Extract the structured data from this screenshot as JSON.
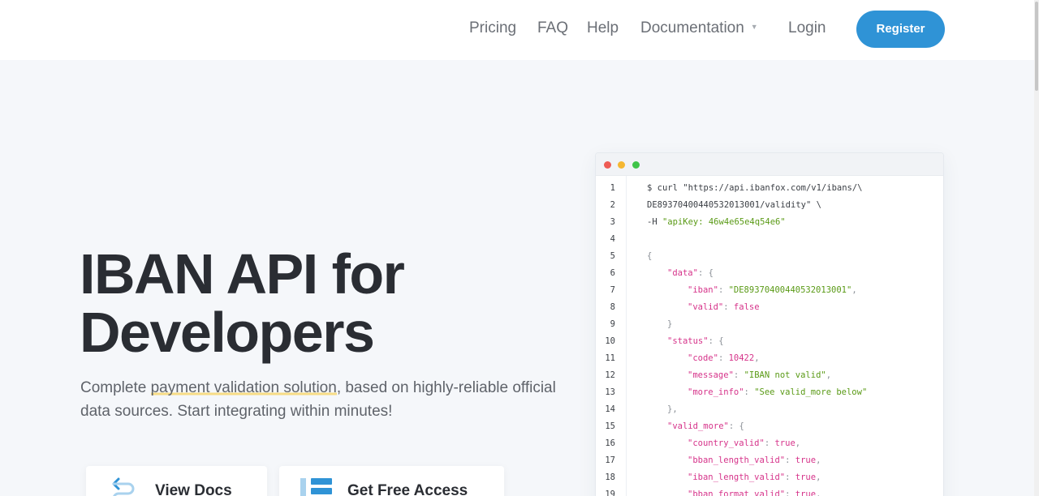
{
  "nav": {
    "links": [
      "Pricing",
      "FAQ",
      "Help",
      "Documentation",
      "Login"
    ],
    "register": "Register"
  },
  "hero": {
    "title_line1": "IBAN API for",
    "title_line2": "Developers",
    "subtitle_before": "Complete ",
    "subtitle_highlight": "payment validation solution",
    "subtitle_after": ", based on highly-reliable official data sources. Start integrating within minutes!"
  },
  "cta": {
    "docs_label": "View Docs",
    "access_label": "Get Free Access"
  },
  "colors": {
    "brand": "#2f93d6",
    "highlight": "#f7dc85",
    "code_key": "#d6338a",
    "code_string": "#5a9a16"
  },
  "code": {
    "lines": [
      {
        "n": "1",
        "indent": 0,
        "tokens": [
          [
            "plain",
            "$ curl \"https://api.ibanfox.com/v1/ibans/\\"
          ]
        ]
      },
      {
        "n": "2",
        "indent": 0,
        "tokens": [
          [
            "plain",
            "DE89370400440532013001/validity\" \\"
          ]
        ]
      },
      {
        "n": "3",
        "indent": 0,
        "tokens": [
          [
            "plain",
            "-H "
          ],
          [
            "str",
            "\"apiKey: 46w4e65e4q54e6\""
          ]
        ]
      },
      {
        "n": "4",
        "indent": 0,
        "tokens": []
      },
      {
        "n": "5",
        "indent": 0,
        "tokens": [
          [
            "punct",
            "{"
          ]
        ]
      },
      {
        "n": "6",
        "indent": 1,
        "tokens": [
          [
            "key",
            "\"data\""
          ],
          [
            "punct",
            ": {"
          ]
        ]
      },
      {
        "n": "7",
        "indent": 2,
        "tokens": [
          [
            "key",
            "\"iban\""
          ],
          [
            "punct",
            ": "
          ],
          [
            "str",
            "\"DE89370400440532013001\""
          ],
          [
            "punct",
            ","
          ]
        ]
      },
      {
        "n": "8",
        "indent": 2,
        "tokens": [
          [
            "key",
            "\"valid\""
          ],
          [
            "punct",
            ": "
          ],
          [
            "bool",
            "false"
          ]
        ]
      },
      {
        "n": "9",
        "indent": 1,
        "tokens": [
          [
            "punct",
            "}"
          ]
        ]
      },
      {
        "n": "10",
        "indent": 1,
        "tokens": [
          [
            "key",
            "\"status\""
          ],
          [
            "punct",
            ": {"
          ]
        ]
      },
      {
        "n": "11",
        "indent": 2,
        "tokens": [
          [
            "key",
            "\"code\""
          ],
          [
            "punct",
            ": "
          ],
          [
            "num",
            "10422"
          ],
          [
            "punct",
            ","
          ]
        ]
      },
      {
        "n": "12",
        "indent": 2,
        "tokens": [
          [
            "key",
            "\"message\""
          ],
          [
            "punct",
            ": "
          ],
          [
            "str",
            "\"IBAN not valid\""
          ],
          [
            "punct",
            ","
          ]
        ]
      },
      {
        "n": "13",
        "indent": 2,
        "tokens": [
          [
            "key",
            "\"more_info\""
          ],
          [
            "punct",
            ": "
          ],
          [
            "str",
            "\"See valid_more below\""
          ]
        ]
      },
      {
        "n": "14",
        "indent": 1,
        "tokens": [
          [
            "punct",
            "},"
          ]
        ]
      },
      {
        "n": "15",
        "indent": 1,
        "tokens": [
          [
            "key",
            "\"valid_more\""
          ],
          [
            "punct",
            ": {"
          ]
        ]
      },
      {
        "n": "16",
        "indent": 2,
        "tokens": [
          [
            "key",
            "\"country_valid\""
          ],
          [
            "punct",
            ": "
          ],
          [
            "bool",
            "true"
          ],
          [
            "punct",
            ","
          ]
        ]
      },
      {
        "n": "17",
        "indent": 2,
        "tokens": [
          [
            "key",
            "\"bban_length_valid\""
          ],
          [
            "punct",
            ": "
          ],
          [
            "bool",
            "true"
          ],
          [
            "punct",
            ","
          ]
        ]
      },
      {
        "n": "18",
        "indent": 2,
        "tokens": [
          [
            "key",
            "\"iban_length_valid\""
          ],
          [
            "punct",
            ": "
          ],
          [
            "bool",
            "true"
          ],
          [
            "punct",
            ","
          ]
        ]
      },
      {
        "n": "19",
        "indent": 2,
        "tokens": [
          [
            "key",
            "\"bban_format_valid\""
          ],
          [
            "punct",
            ": "
          ],
          [
            "bool",
            "true"
          ],
          [
            "punct",
            ","
          ]
        ]
      }
    ]
  }
}
